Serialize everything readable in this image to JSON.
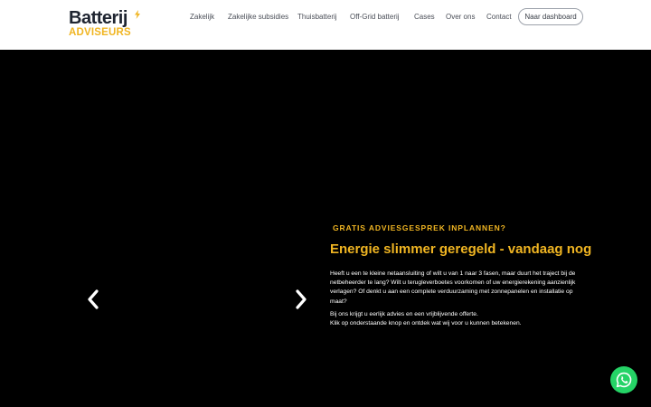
{
  "brand": {
    "logo_top": "Batterij",
    "logo_bottom": "ADVISEURS"
  },
  "nav": {
    "items": [
      "Zakelijk",
      "Zakelijke subsidies",
      "Thuisbatterij",
      "Off-Grid batterij",
      "Cases",
      "Over ons",
      "Contact"
    ],
    "dashboard_label": "Naar dashboard"
  },
  "hero": {
    "kicker": "GRATIS ADVIESGESPREK INPLANNEN?",
    "headline": "Energie slimmer geregeld - vandaag nog",
    "paragraph1": "Heeft u een te kleine netaansluiting of wilt u van 1 naar 3 fasen, maar duurt het traject bij de netbeheerder te lang? Wilt u terugleverboetes voorkomen of uw energierekening aanzienlijk verlagen? Of denkt u aan een complete verduurzaming met zonnepanelen en installatie op maat?",
    "paragraph2_line1": "Bij ons krijgt u eerlijk advies en een vrijblijvende offerte.",
    "paragraph2_line2": "Klik op onderstaande knop en ontdek wat wij voor u kunnen betekenen."
  },
  "icons": {
    "prev": "chevron-left-icon",
    "next": "chevron-right-icon",
    "chat": "whatsapp-icon"
  },
  "colors": {
    "accent": "#f0b522",
    "header_bg": "#ffffff",
    "hero_bg": "#000000",
    "whatsapp": "#25d366"
  }
}
